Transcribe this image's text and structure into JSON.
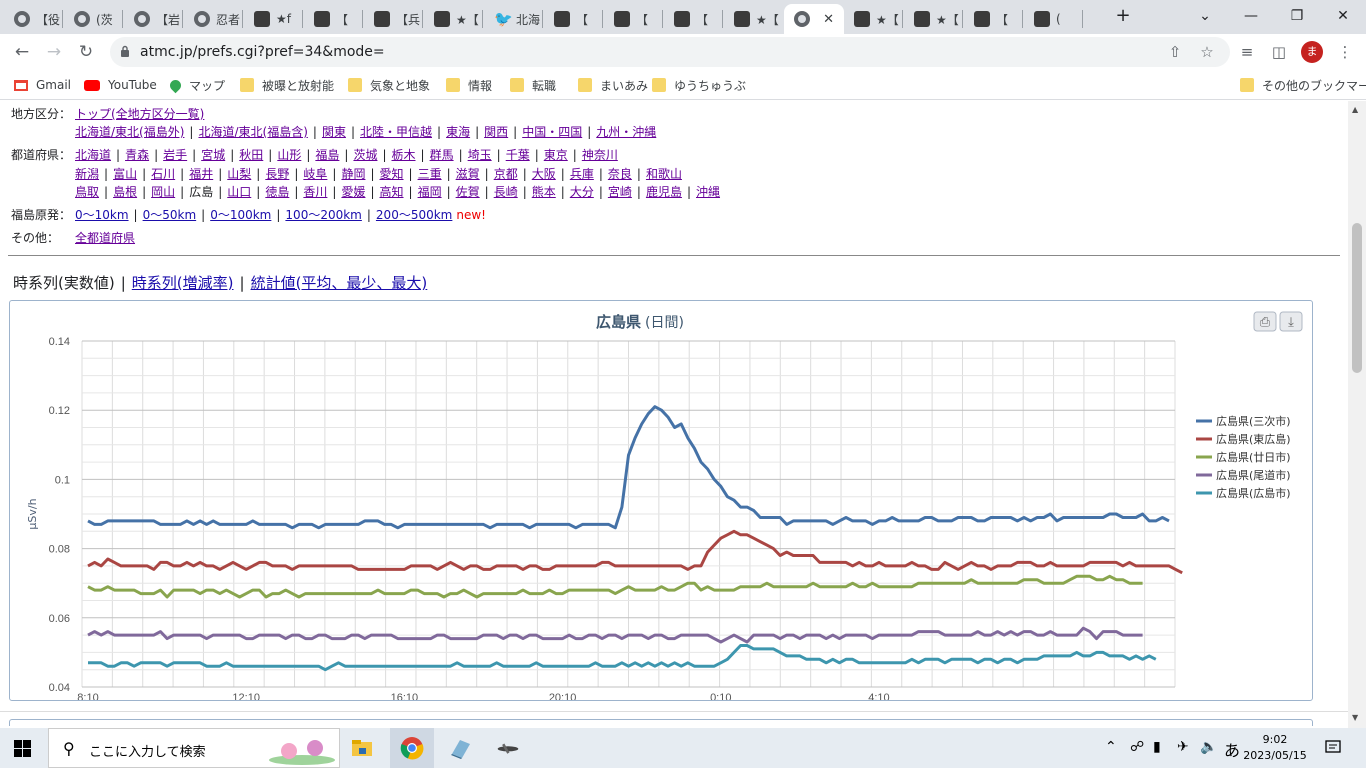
{
  "tabs": [
    {
      "title": "【役",
      "icon": "globe-icon"
    },
    {
      "title": "(茨",
      "icon": "globe-icon"
    },
    {
      "title": "【岩",
      "icon": "globe-icon"
    },
    {
      "title": "忍者",
      "icon": "globe-icon"
    },
    {
      "title": "★f",
      "icon": "atmc-icon"
    },
    {
      "title": "【",
      "icon": "atmc-icon"
    },
    {
      "title": "【兵",
      "icon": "atmc-icon"
    },
    {
      "title": "★【",
      "icon": "atmc-icon"
    },
    {
      "title": "北海",
      "icon": "twitter-icon"
    },
    {
      "title": "【",
      "icon": "atmc-icon"
    },
    {
      "title": "【",
      "icon": "atmc-icon"
    },
    {
      "title": "【",
      "icon": "atmc-icon"
    },
    {
      "title": "★【",
      "icon": "atmc-icon"
    },
    {
      "title": "",
      "icon": "globe-icon",
      "active": true
    },
    {
      "title": "★【",
      "icon": "atmc-icon"
    },
    {
      "title": "★【",
      "icon": "atmc-icon"
    },
    {
      "title": "【",
      "icon": "atmc-icon"
    },
    {
      "title": "(",
      "icon": "atmc-icon"
    }
  ],
  "address": {
    "url": "atmc.jp/prefs.cgi?pref=34&mode="
  },
  "profile": {
    "initial": "ま"
  },
  "bookmarks": [
    {
      "label": "Gmail",
      "icon": "gmail-icon"
    },
    {
      "label": "YouTube",
      "icon": "youtube-icon"
    },
    {
      "label": "マップ",
      "icon": "maps-icon"
    },
    {
      "label": "被曝と放射能",
      "icon": "folder-icon"
    },
    {
      "label": "気象と地象",
      "icon": "folder-icon"
    },
    {
      "label": "情報",
      "icon": "folder-icon"
    },
    {
      "label": "転職",
      "icon": "folder-icon"
    },
    {
      "label": "まいあみ",
      "icon": "folder-icon"
    },
    {
      "label": "ゆうちゅうぶ",
      "icon": "folder-icon"
    }
  ],
  "bookmarks_other": "その他のブックマーク",
  "nav": {
    "region_label": "地方区分：",
    "region_top": "トップ(全地方区分一覧)",
    "regions": [
      "北海道/東北(福島外)",
      "北海道/東北(福島含)",
      "関東",
      "北陸・甲信越",
      "東海",
      "関西",
      "中国・四国",
      "九州・沖縄"
    ],
    "pref_label": "都道府県：",
    "prefs_row1": [
      "北海道",
      "青森",
      "岩手",
      "宮城",
      "秋田",
      "山形",
      "福島",
      "茨城",
      "栃木",
      "群馬",
      "埼玉",
      "千葉",
      "東京",
      "神奈川"
    ],
    "prefs_row2": [
      "新潟",
      "富山",
      "石川",
      "福井",
      "山梨",
      "長野",
      "岐阜",
      "静岡",
      "愛知",
      "三重",
      "滋賀",
      "京都",
      "大阪",
      "兵庫",
      "奈良",
      "和歌山"
    ],
    "prefs_row3": [
      "鳥取",
      "島根",
      "岡山",
      "広島",
      "山口",
      "徳島",
      "香川",
      "愛媛",
      "高知",
      "福岡",
      "佐賀",
      "長崎",
      "熊本",
      "大分",
      "宮崎",
      "鹿児島",
      "沖縄"
    ],
    "current_pref": "広島",
    "fukushima_label": "福島原発：",
    "fukushima": [
      "0〜10km",
      "0〜50km",
      "0〜100km",
      "100〜200km",
      "200〜500km"
    ],
    "new_badge": "new!",
    "other_label": "その他：",
    "other": [
      "全都道府県"
    ]
  },
  "views": {
    "current": "時系列(実数値)",
    "links": [
      "時系列(増減率)",
      "統計値(平均、最少、最大)"
    ]
  },
  "chart_data": {
    "type": "line",
    "title": "広島県",
    "subtitle": "(日間)",
    "ylabel": "μSv/h",
    "xlabel": "",
    "ylim": [
      0.04,
      0.14
    ],
    "yticks": [
      0.04,
      0.06,
      0.08,
      0.1,
      0.12,
      0.14
    ],
    "ytick_labels": [
      "0.04",
      "0.06",
      "0.08",
      "0.1",
      "0.12",
      "0.14"
    ],
    "xtick_labels": [
      "8:10",
      "12:10",
      "16:10",
      "20:10",
      "0:10",
      "4:10"
    ],
    "x_interval_minutes": 10,
    "grid": true,
    "legend_position": "right",
    "series": [
      {
        "name": "広島県(三次市)",
        "color": "#4572a7",
        "values": [
          0.088,
          0.087,
          0.087,
          0.088,
          0.088,
          0.088,
          0.088,
          0.088,
          0.088,
          0.088,
          0.088,
          0.087,
          0.087,
          0.087,
          0.087,
          0.088,
          0.087,
          0.088,
          0.087,
          0.088,
          0.087,
          0.087,
          0.087,
          0.087,
          0.087,
          0.088,
          0.087,
          0.087,
          0.087,
          0.087,
          0.087,
          0.086,
          0.087,
          0.087,
          0.087,
          0.086,
          0.087,
          0.087,
          0.087,
          0.087,
          0.087,
          0.087,
          0.088,
          0.088,
          0.088,
          0.087,
          0.087,
          0.086,
          0.087,
          0.087,
          0.087,
          0.087,
          0.087,
          0.087,
          0.087,
          0.087,
          0.087,
          0.087,
          0.087,
          0.087,
          0.087,
          0.086,
          0.087,
          0.087,
          0.087,
          0.087,
          0.087,
          0.086,
          0.087,
          0.087,
          0.087,
          0.087,
          0.087,
          0.087,
          0.086,
          0.087,
          0.087,
          0.087,
          0.087,
          0.087,
          0.086,
          0.092,
          0.107,
          0.112,
          0.116,
          0.119,
          0.121,
          0.12,
          0.118,
          0.115,
          0.116,
          0.112,
          0.109,
          0.105,
          0.103,
          0.1,
          0.098,
          0.095,
          0.094,
          0.092,
          0.092,
          0.091,
          0.089,
          0.089,
          0.089,
          0.089,
          0.087,
          0.088,
          0.088,
          0.088,
          0.088,
          0.088,
          0.088,
          0.087,
          0.088,
          0.089,
          0.088,
          0.088,
          0.088,
          0.087,
          0.088,
          0.088,
          0.089,
          0.088,
          0.088,
          0.088,
          0.088,
          0.089,
          0.089,
          0.088,
          0.088,
          0.088,
          0.089,
          0.089,
          0.089,
          0.088,
          0.088,
          0.089,
          0.089,
          0.089,
          0.089,
          0.088,
          0.089,
          0.088,
          0.089,
          0.089,
          0.09,
          0.088,
          0.089,
          0.089,
          0.089,
          0.089,
          0.089,
          0.089,
          0.089,
          0.09,
          0.09,
          0.089,
          0.089,
          0.089,
          0.09,
          0.088,
          0.088,
          0.089,
          0.088
        ]
      },
      {
        "name": "広島県(東広島)",
        "color": "#aa4643",
        "values": [
          0.075,
          0.076,
          0.075,
          0.077,
          0.076,
          0.075,
          0.075,
          0.075,
          0.075,
          0.075,
          0.074,
          0.076,
          0.076,
          0.075,
          0.075,
          0.076,
          0.075,
          0.076,
          0.075,
          0.075,
          0.074,
          0.075,
          0.076,
          0.075,
          0.074,
          0.075,
          0.076,
          0.076,
          0.075,
          0.075,
          0.075,
          0.074,
          0.075,
          0.075,
          0.075,
          0.075,
          0.075,
          0.075,
          0.075,
          0.075,
          0.075,
          0.074,
          0.074,
          0.074,
          0.074,
          0.074,
          0.074,
          0.074,
          0.074,
          0.075,
          0.075,
          0.075,
          0.075,
          0.074,
          0.075,
          0.076,
          0.075,
          0.074,
          0.075,
          0.075,
          0.074,
          0.074,
          0.075,
          0.075,
          0.075,
          0.075,
          0.074,
          0.075,
          0.075,
          0.074,
          0.074,
          0.075,
          0.075,
          0.075,
          0.075,
          0.075,
          0.075,
          0.075,
          0.076,
          0.076,
          0.075,
          0.075,
          0.075,
          0.075,
          0.075,
          0.075,
          0.075,
          0.075,
          0.075,
          0.075,
          0.075,
          0.074,
          0.075,
          0.075,
          0.079,
          0.081,
          0.083,
          0.084,
          0.085,
          0.084,
          0.084,
          0.083,
          0.082,
          0.081,
          0.08,
          0.078,
          0.079,
          0.078,
          0.078,
          0.078,
          0.078,
          0.076,
          0.076,
          0.076,
          0.076,
          0.076,
          0.075,
          0.076,
          0.075,
          0.075,
          0.076,
          0.075,
          0.075,
          0.075,
          0.075,
          0.076,
          0.075,
          0.075,
          0.074,
          0.074,
          0.076,
          0.075,
          0.074,
          0.075,
          0.076,
          0.075,
          0.075,
          0.074,
          0.075,
          0.075,
          0.075,
          0.076,
          0.076,
          0.076,
          0.075,
          0.075,
          0.076,
          0.075,
          0.075,
          0.075,
          0.075,
          0.075,
          0.076,
          0.076,
          0.076,
          0.076,
          0.076,
          0.075,
          0.076,
          0.075,
          0.075,
          0.075,
          0.075,
          0.075,
          0.075,
          0.074,
          0.073
        ]
      },
      {
        "name": "広島県(廿日市)",
        "color": "#89a54e",
        "values": [
          0.069,
          0.068,
          0.068,
          0.069,
          0.068,
          0.068,
          0.068,
          0.068,
          0.067,
          0.067,
          0.067,
          0.068,
          0.066,
          0.068,
          0.068,
          0.068,
          0.068,
          0.067,
          0.068,
          0.068,
          0.067,
          0.068,
          0.067,
          0.066,
          0.067,
          0.068,
          0.068,
          0.066,
          0.067,
          0.067,
          0.068,
          0.067,
          0.066,
          0.067,
          0.067,
          0.067,
          0.067,
          0.067,
          0.067,
          0.067,
          0.067,
          0.067,
          0.067,
          0.067,
          0.068,
          0.067,
          0.067,
          0.067,
          0.067,
          0.068,
          0.068,
          0.067,
          0.067,
          0.067,
          0.066,
          0.067,
          0.067,
          0.068,
          0.067,
          0.066,
          0.067,
          0.067,
          0.067,
          0.067,
          0.067,
          0.067,
          0.068,
          0.067,
          0.067,
          0.067,
          0.068,
          0.067,
          0.067,
          0.068,
          0.068,
          0.068,
          0.068,
          0.068,
          0.068,
          0.068,
          0.067,
          0.068,
          0.069,
          0.068,
          0.068,
          0.068,
          0.068,
          0.069,
          0.068,
          0.068,
          0.069,
          0.07,
          0.07,
          0.068,
          0.069,
          0.068,
          0.068,
          0.068,
          0.068,
          0.069,
          0.069,
          0.069,
          0.069,
          0.07,
          0.069,
          0.069,
          0.069,
          0.069,
          0.069,
          0.069,
          0.07,
          0.069,
          0.069,
          0.069,
          0.069,
          0.069,
          0.07,
          0.069,
          0.069,
          0.07,
          0.069,
          0.069,
          0.069,
          0.069,
          0.069,
          0.069,
          0.07,
          0.07,
          0.07,
          0.07,
          0.07,
          0.07,
          0.07,
          0.07,
          0.071,
          0.07,
          0.07,
          0.07,
          0.07,
          0.07,
          0.07,
          0.07,
          0.071,
          0.071,
          0.071,
          0.07,
          0.07,
          0.07,
          0.07,
          0.071,
          0.072,
          0.072,
          0.072,
          0.071,
          0.071,
          0.072,
          0.071,
          0.071,
          0.07,
          0.07,
          0.07
        ]
      },
      {
        "name": "広島県(尾道市)",
        "color": "#80699b",
        "values": [
          0.055,
          0.056,
          0.055,
          0.056,
          0.055,
          0.055,
          0.055,
          0.055,
          0.055,
          0.055,
          0.055,
          0.056,
          0.054,
          0.055,
          0.055,
          0.055,
          0.055,
          0.055,
          0.054,
          0.055,
          0.055,
          0.055,
          0.055,
          0.055,
          0.054,
          0.054,
          0.055,
          0.055,
          0.055,
          0.055,
          0.054,
          0.055,
          0.055,
          0.054,
          0.054,
          0.055,
          0.055,
          0.054,
          0.054,
          0.054,
          0.055,
          0.055,
          0.054,
          0.055,
          0.055,
          0.055,
          0.055,
          0.054,
          0.054,
          0.054,
          0.054,
          0.054,
          0.054,
          0.055,
          0.055,
          0.054,
          0.054,
          0.054,
          0.054,
          0.054,
          0.055,
          0.055,
          0.055,
          0.054,
          0.055,
          0.055,
          0.054,
          0.055,
          0.055,
          0.054,
          0.054,
          0.054,
          0.054,
          0.055,
          0.054,
          0.054,
          0.055,
          0.055,
          0.054,
          0.055,
          0.055,
          0.054,
          0.055,
          0.055,
          0.055,
          0.054,
          0.055,
          0.055,
          0.054,
          0.054,
          0.055,
          0.055,
          0.055,
          0.055,
          0.055,
          0.054,
          0.053,
          0.054,
          0.055,
          0.054,
          0.053,
          0.055,
          0.055,
          0.055,
          0.055,
          0.054,
          0.055,
          0.055,
          0.054,
          0.055,
          0.055,
          0.055,
          0.054,
          0.055,
          0.054,
          0.055,
          0.055,
          0.055,
          0.055,
          0.054,
          0.055,
          0.055,
          0.055,
          0.055,
          0.055,
          0.055,
          0.056,
          0.056,
          0.056,
          0.056,
          0.055,
          0.055,
          0.055,
          0.055,
          0.055,
          0.056,
          0.055,
          0.055,
          0.056,
          0.055,
          0.056,
          0.055,
          0.056,
          0.056,
          0.055,
          0.055,
          0.056,
          0.055,
          0.055,
          0.055,
          0.055,
          0.057,
          0.056,
          0.054,
          0.056,
          0.056,
          0.056,
          0.055,
          0.055,
          0.055,
          0.055
        ]
      },
      {
        "name": "広島県(広島市)",
        "color": "#3d96ae",
        "values": [
          0.047,
          0.047,
          0.047,
          0.046,
          0.046,
          0.047,
          0.047,
          0.046,
          0.047,
          0.047,
          0.047,
          0.047,
          0.046,
          0.047,
          0.047,
          0.047,
          0.047,
          0.047,
          0.046,
          0.046,
          0.046,
          0.047,
          0.046,
          0.046,
          0.046,
          0.046,
          0.046,
          0.046,
          0.046,
          0.046,
          0.046,
          0.046,
          0.046,
          0.046,
          0.046,
          0.046,
          0.045,
          0.046,
          0.047,
          0.046,
          0.046,
          0.046,
          0.046,
          0.046,
          0.046,
          0.046,
          0.046,
          0.046,
          0.046,
          0.046,
          0.046,
          0.046,
          0.046,
          0.046,
          0.046,
          0.046,
          0.047,
          0.046,
          0.046,
          0.046,
          0.046,
          0.046,
          0.047,
          0.046,
          0.046,
          0.046,
          0.046,
          0.046,
          0.047,
          0.046,
          0.046,
          0.046,
          0.046,
          0.046,
          0.046,
          0.046,
          0.046,
          0.047,
          0.046,
          0.046,
          0.046,
          0.047,
          0.046,
          0.047,
          0.046,
          0.047,
          0.046,
          0.047,
          0.046,
          0.047,
          0.046,
          0.047,
          0.046,
          0.046,
          0.046,
          0.046,
          0.047,
          0.048,
          0.05,
          0.052,
          0.052,
          0.051,
          0.051,
          0.051,
          0.051,
          0.05,
          0.049,
          0.049,
          0.049,
          0.048,
          0.048,
          0.048,
          0.047,
          0.048,
          0.047,
          0.048,
          0.048,
          0.047,
          0.047,
          0.047,
          0.047,
          0.047,
          0.047,
          0.047,
          0.047,
          0.048,
          0.047,
          0.048,
          0.048,
          0.048,
          0.047,
          0.048,
          0.048,
          0.048,
          0.048,
          0.047,
          0.048,
          0.048,
          0.047,
          0.048,
          0.048,
          0.047,
          0.048,
          0.048,
          0.048,
          0.049,
          0.049,
          0.049,
          0.049,
          0.049,
          0.05,
          0.049,
          0.049,
          0.05,
          0.05,
          0.049,
          0.049,
          0.049,
          0.048,
          0.049,
          0.048,
          0.049,
          0.048
        ]
      }
    ]
  },
  "taskbar": {
    "search_placeholder": "ここに入力して検索",
    "ime": "あ",
    "time": "9:02",
    "date": "2023/05/15"
  }
}
